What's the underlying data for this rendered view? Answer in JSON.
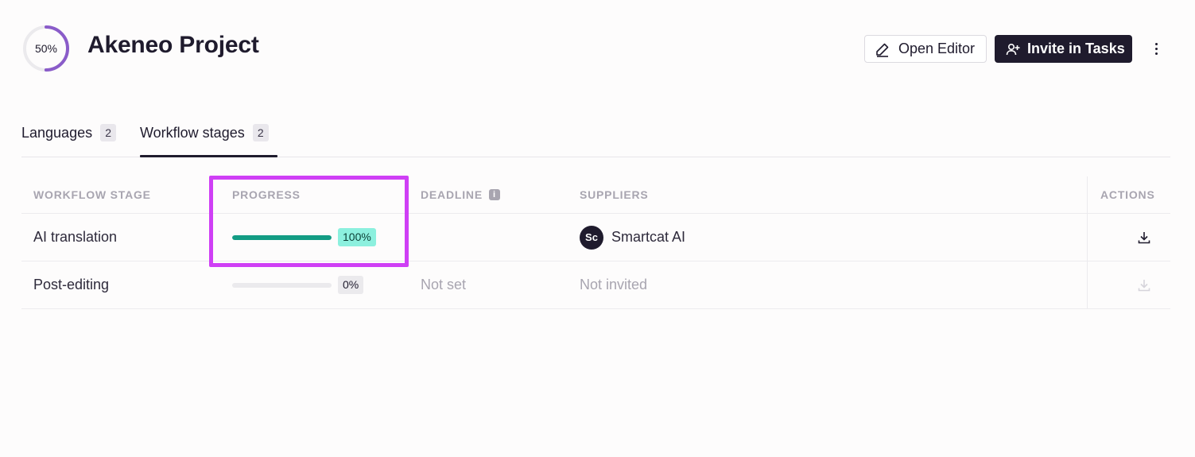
{
  "project": {
    "progress_label": "50%",
    "progress_value": 0.5,
    "title": "Akeneo Project"
  },
  "header_actions": {
    "open_editor_label": "Open Editor",
    "invite_label": "Invite in Tasks",
    "more_icon": "kebab-icon"
  },
  "tabs": [
    {
      "label": "Languages",
      "count": "2",
      "active": false
    },
    {
      "label": "Workflow stages",
      "count": "2",
      "active": true
    }
  ],
  "table": {
    "columns": {
      "stage": "WORKFLOW STAGE",
      "progress": "PROGRESS",
      "deadline": "DEADLINE",
      "suppliers": "SUPPLIERS",
      "actions": "ACTIONS"
    },
    "rows": [
      {
        "stage": "AI translation",
        "progress_label": "100%",
        "progress_value": 1.0,
        "deadline": "",
        "supplier": "Smartcat AI",
        "supplier_avatar": "Sc",
        "download_enabled": true
      },
      {
        "stage": "Post-editing",
        "progress_label": "0%",
        "progress_value": 0.0,
        "deadline": "Not set",
        "supplier": "Not invited",
        "download_enabled": false
      }
    ]
  },
  "colors": {
    "accent_ring": "#8a5cc9",
    "progress_fill": "#139c84",
    "progress_badge_done": "#8cf0de",
    "highlight_box": "#cf3ff5",
    "dark_button": "#1f1b2d"
  }
}
